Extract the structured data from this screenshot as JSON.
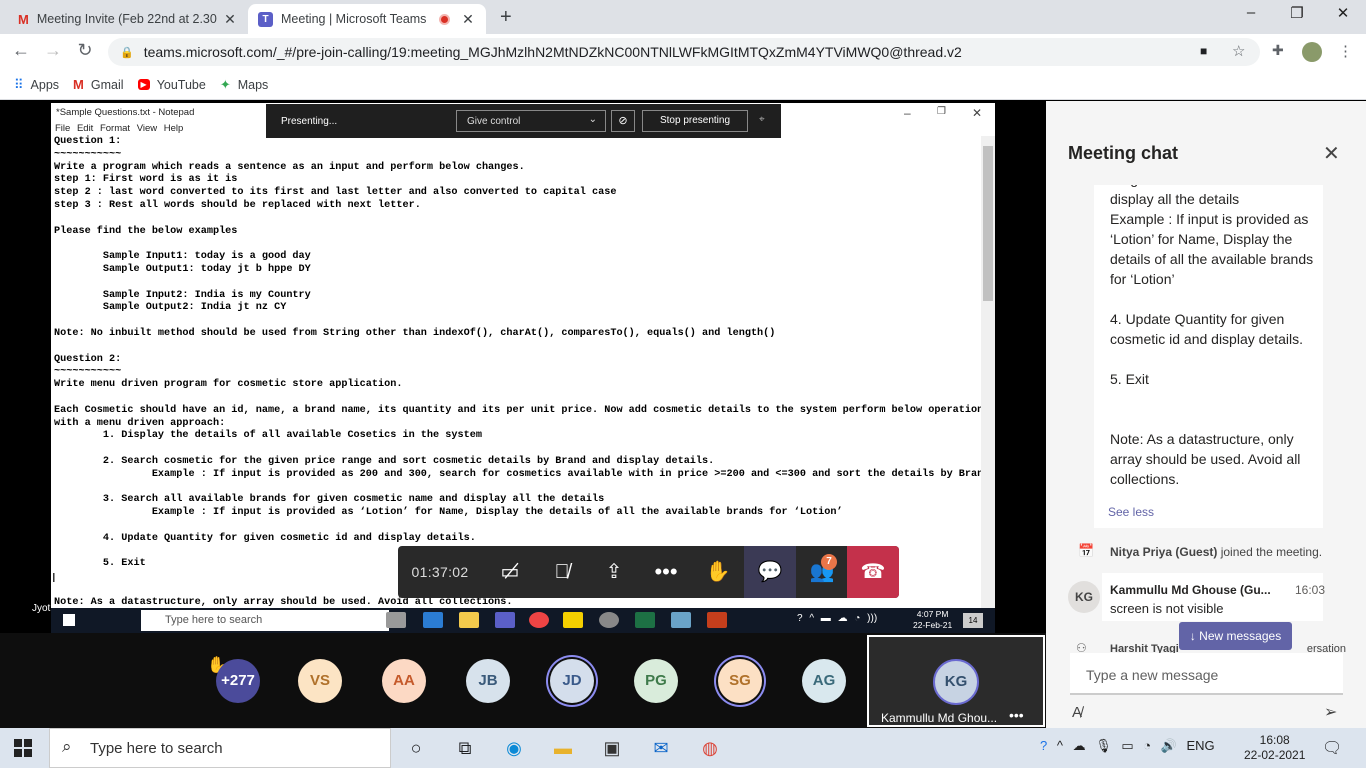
{
  "browser": {
    "tabs": [
      {
        "title": "Meeting Invite (Feb 22nd at 2.30",
        "icon": "gmail-icon"
      },
      {
        "title": "Meeting | Microsoft Teams",
        "icon": "teams-icon",
        "recording": true
      }
    ],
    "url": "teams.microsoft.com/_#/pre-join-calling/19:meeting_MGJhMzlhN2MtNDZkNC00NTNlLWFkMGItMTQxZmM4YTViMWQ0@thread.v2",
    "bookmarks": [
      "Apps",
      "Gmail",
      "YouTube",
      "Maps"
    ]
  },
  "notepad": {
    "title": "*Sample Questions.txt - Notepad",
    "menu": [
      "File",
      "Edit",
      "Format",
      "View",
      "Help"
    ],
    "text": "Question 1:\n~~~~~~~~~~~\nWrite a program which reads a sentence as an input and perform below changes.\nstep 1: First word is as it is\nstep 2 : last word converted to its first and last letter and also converted to capital case\nstep 3 : Rest all words should be replaced with next letter.\n\nPlease find the below examples\n\n        Sample Input1: today is a good day\n        Sample Output1: today jt b hppe DY\n\n        Sample Input2: India is my Country\n        Sample Output2: India jt nz CY\n\nNote: No inbuilt method should be used from String other than indexOf(), charAt(), comparesTo(), equals() and length()\n\nQuestion 2:\n~~~~~~~~~~~\nWrite menu driven program for cosmetic store application.\n\nEach Cosmetic should have an id, name, a brand name, its quantity and its per unit price. Now add cosmetic details to the system perform below operation\nwith a menu driven approach:\n        1. Display the details of all available Cosetics in the system\n\n        2. Search cosmetic for the given price range and sort cosmetic details by Brand and display details.\n                Example : If input is provided as 200 and 300, search for cosmetics available with in price >=200 and <=300 and sort the details by Brand\n\n        3. Search all available brands for given cosmetic name and display all the details\n                Example : If input is provided as ‘Lotion’ for Name, Display the details of all the available brands for ‘Lotion’\n\n        4. Update Quantity for given cosmetic id and display details.\n\n        5. Exit\n\n\nNote: As a datastructure, only array should be used. Avoid all collections."
  },
  "presenting_bar": {
    "status": "Presenting...",
    "give_control": "Give control",
    "stop": "Stop presenting"
  },
  "controls": {
    "timer": "01:37:02",
    "participants_badge": "7"
  },
  "presenter_name": "Jyoti Prakash Behera",
  "inner_taskbar": {
    "search_placeholder": "Type here to search",
    "time": "4:07 PM",
    "date": "22-Feb-21",
    "notif_count": "14"
  },
  "participants": [
    {
      "initials": "+277",
      "bg": "#4b4b9b",
      "fg": "#ffffff"
    },
    {
      "initials": "VS",
      "bg": "#fce4c4",
      "fg": "#b0712a"
    },
    {
      "initials": "AA",
      "bg": "#fcd9c4",
      "fg": "#c55a2b"
    },
    {
      "initials": "JB",
      "bg": "#d7e2ec",
      "fg": "#3a5a7a"
    },
    {
      "initials": "JD",
      "bg": "#d4deec",
      "fg": "#3a5a8a"
    },
    {
      "initials": "PG",
      "bg": "#d9ecdb",
      "fg": "#3e7a4a"
    },
    {
      "initials": "SG",
      "bg": "#fce0c4",
      "fg": "#b0712a"
    },
    {
      "initials": "AG",
      "bg": "#d9e8ee",
      "fg": "#3a6a7a"
    }
  ],
  "featured": {
    "initials": "KG",
    "name": "Kammullu Md Ghou..."
  },
  "chat": {
    "title": "Meeting chat",
    "card_lines": [
      "for given cosmetic name and display all the details",
      "Example : If input is provided as ‘Lotion’ for Name, Display the details of all the available brands for ‘Lotion’",
      "",
      "4. Update Quantity for given cosmetic id and display details.",
      "",
      "5. Exit",
      "",
      "",
      "Note: As a datastructure, only array should be used. Avoid all collections."
    ],
    "see_less": "See less",
    "system_message": {
      "name": "Nitya Priya (Guest)",
      "text": " joined the meeting."
    },
    "message": {
      "initials": "KG",
      "name": "Kammullu Md Ghouse (Gu...",
      "time": "16:03",
      "text": "screen is not visible"
    },
    "peek_name": "Harshit Tyagi",
    "peek_suffix": "ersation",
    "new_messages": "New messages",
    "compose_placeholder": "Type a new message"
  },
  "taskbar": {
    "search_placeholder": "Type here to search",
    "lang": "ENG",
    "time": "16:08",
    "date": "22-02-2021"
  }
}
